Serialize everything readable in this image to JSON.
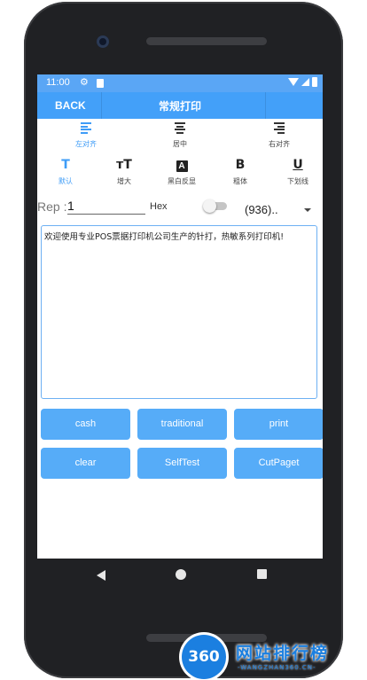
{
  "status": {
    "time": "11:00"
  },
  "appbar": {
    "back_label": "BACK",
    "title": "常规打印"
  },
  "alignment": [
    {
      "label": "左对齐",
      "icon": "align-left-icon",
      "active": true
    },
    {
      "label": "居中",
      "icon": "align-center-icon",
      "active": false
    },
    {
      "label": "右对齐",
      "icon": "align-right-icon",
      "active": false
    }
  ],
  "format": [
    {
      "label": "默认",
      "glyph": "T",
      "icon": "text-default-icon",
      "active": true
    },
    {
      "label": "增大",
      "glyph": "тT",
      "icon": "text-size-icon",
      "active": false
    },
    {
      "label": "黑白反显",
      "glyph": "A",
      "icon": "invert-icon",
      "active": false
    },
    {
      "label": "粗体",
      "glyph": "B",
      "icon": "bold-icon",
      "active": false
    },
    {
      "label": "下划线",
      "glyph": "U",
      "icon": "underline-icon",
      "active": false
    }
  ],
  "rep": {
    "label": "Rep :",
    "value": "1"
  },
  "hex": {
    "label": "Hex",
    "enabled": false
  },
  "spinner": {
    "value": "(936).."
  },
  "textbox": {
    "value": "欢迎使用专业POS票据打印机公司生产的针打，热敏系列打印机!"
  },
  "buttons": [
    {
      "label": "cash",
      "name": "cash-button"
    },
    {
      "label": "traditional",
      "name": "traditional-button"
    },
    {
      "label": "print",
      "name": "print-button"
    },
    {
      "label": "clear",
      "name": "clear-button"
    },
    {
      "label": "SelfTest",
      "name": "selftest-button"
    },
    {
      "label": "CutPaget",
      "name": "cutpaget-button"
    }
  ],
  "watermark": {
    "logo_text": "360",
    "title": "网站排行榜",
    "url": "-WANGZHAN360.CN-"
  },
  "colors": {
    "accent": "#43a0f9",
    "button": "#56acf8",
    "active": "#3e9cf7",
    "phone": "#202124"
  }
}
